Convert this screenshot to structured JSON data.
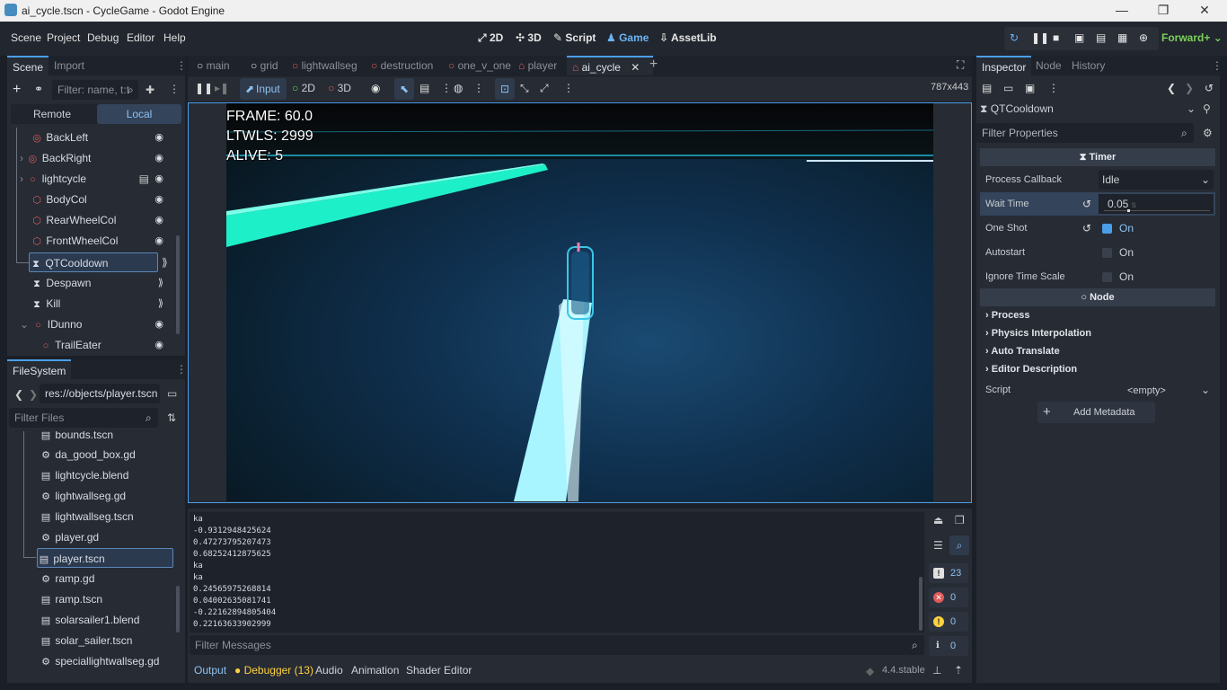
{
  "window": {
    "title": "ai_cycle.tscn - CycleGame - Godot Engine",
    "min": "—",
    "max": "❐",
    "close": "✕"
  },
  "menu": [
    "Scene",
    "Project",
    "Debug",
    "Editor",
    "Help"
  ],
  "workspaces": {
    "items": [
      "2D",
      "3D",
      "Script",
      "Game",
      "AssetLib"
    ],
    "active": "Game"
  },
  "renderer": "Forward+",
  "scene_dock": {
    "tabs": [
      "Scene",
      "Import"
    ],
    "filter_placeholder": "Filter: name, t:t",
    "remote": "Remote",
    "local": "Local",
    "nodes": [
      {
        "name": "BackLeft",
        "icon": "target-icon",
        "color": "#e05a5a"
      },
      {
        "name": "BackRight",
        "icon": "target-icon",
        "color": "#e05a5a"
      },
      {
        "name": "lightcycle",
        "icon": "node3d-icon",
        "color": "#e05a5a"
      },
      {
        "name": "BodyCol",
        "icon": "collision-icon",
        "color": "#e05a5a"
      },
      {
        "name": "RearWheelCol",
        "icon": "collision-icon",
        "color": "#e05a5a"
      },
      {
        "name": "FrontWheelCol",
        "icon": "collision-icon",
        "color": "#e05a5a"
      },
      {
        "name": "QTCooldown",
        "icon": "timer-icon",
        "color": "#e0e0e0"
      },
      {
        "name": "Despawn",
        "icon": "timer-icon",
        "color": "#e0e0e0"
      },
      {
        "name": "Kill",
        "icon": "timer-icon",
        "color": "#e0e0e0"
      },
      {
        "name": "IDunno",
        "icon": "node3d-icon",
        "color": "#e05a5a"
      },
      {
        "name": "TrailEater",
        "icon": "node3d-icon",
        "color": "#e05a5a"
      }
    ],
    "selected": "QTCooldown"
  },
  "filesystem": {
    "title": "FileSystem",
    "path": "res://objects/player.tscn",
    "filter_placeholder": "Filter Files",
    "files": [
      {
        "name": "bounds.tscn",
        "icon": "scene-icon"
      },
      {
        "name": "da_good_box.gd",
        "icon": "gear-icon"
      },
      {
        "name": "lightcycle.blend",
        "icon": "scene-icon"
      },
      {
        "name": "lightwallseg.gd",
        "icon": "gear-icon"
      },
      {
        "name": "lightwallseg.tscn",
        "icon": "scene-icon"
      },
      {
        "name": "player.gd",
        "icon": "gear-icon"
      },
      {
        "name": "player.tscn",
        "icon": "scene-icon"
      },
      {
        "name": "ramp.gd",
        "icon": "gear-icon"
      },
      {
        "name": "ramp.tscn",
        "icon": "scene-icon"
      },
      {
        "name": "solarsailer1.blend",
        "icon": "scene-icon"
      },
      {
        "name": "solar_sailer.tscn",
        "icon": "scene-icon"
      },
      {
        "name": "speciallightwallseg.gd",
        "icon": "gear-icon"
      }
    ],
    "selected": "player.tscn"
  },
  "scene_tabs": [
    "main",
    "grid",
    "lightwallseg",
    "destruction",
    "one_v_one",
    "player",
    "ai_cycle"
  ],
  "active_scene_tab": "ai_cycle",
  "game_toolbar": {
    "input": "Input",
    "2d": "2D",
    "3d": "3D",
    "resolution": "787x443"
  },
  "hud": {
    "frame": "FRAME: 60.0",
    "ltwls": "LTWLS: 2999",
    "alive": "ALIVE: 5"
  },
  "output": {
    "lines": [
      "ka",
      "-0.9312948425624",
      "0.47273795207473",
      "0.68252412875625",
      "ka",
      "ka",
      "0.24565975268814",
      "0.04002635081741",
      "-0.22162894805404",
      "0.22163633902999"
    ],
    "filter_placeholder": "Filter Messages",
    "counts": {
      "messages": "23",
      "errors": "0",
      "warnings": "0",
      "info": "0"
    }
  },
  "bottom_tabs": [
    "Output",
    "Debugger (13)",
    "Audio",
    "Animation",
    "Shader Editor"
  ],
  "version": "4.4.stable",
  "inspector": {
    "tabs": [
      "Inspector",
      "Node",
      "History"
    ],
    "node": "QTCooldown",
    "filter_placeholder": "Filter Properties",
    "timer_header": "Timer",
    "node_header": "Node",
    "props": {
      "process_callback": {
        "label": "Process Callback",
        "value": "Idle"
      },
      "wait_time": {
        "label": "Wait Time",
        "value": "0.05",
        "unit": "s"
      },
      "one_shot": {
        "label": "One Shot",
        "value": "On"
      },
      "autostart": {
        "label": "Autostart",
        "value": "On"
      },
      "ignore_time_scale": {
        "label": "Ignore Time Scale",
        "value": "On"
      }
    },
    "categories": [
      "Process",
      "Physics Interpolation",
      "Auto Translate",
      "Editor Description"
    ],
    "script": {
      "label": "Script",
      "value": "<empty>"
    },
    "add_metadata": "Add Metadata"
  }
}
